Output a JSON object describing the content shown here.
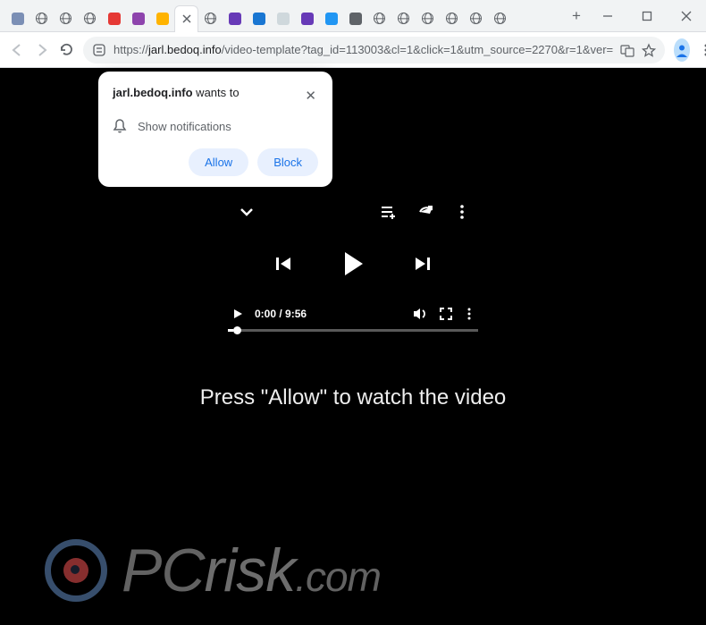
{
  "window": {
    "min": "—",
    "max": "▢",
    "close": "✕"
  },
  "tabs": {
    "count": 21,
    "newtab": "+",
    "colors": [
      "#7b8fb5",
      "#757575",
      "#757575",
      "#757575",
      "#e53935",
      "#8e44ad",
      "#ffb300",
      "#fff",
      "#757575",
      "#673ab7",
      "#1976d2",
      "#cfd8dc",
      "#673ab7",
      "#2196f3",
      "#5f6368",
      "#757575",
      "#757575",
      "#757575",
      "#757575",
      "#757575",
      "#757575"
    ],
    "globe_indexes": [
      1,
      2,
      3,
      8,
      15,
      16,
      17,
      18,
      19,
      20
    ]
  },
  "omnibox": {
    "protocol": "https://",
    "host": "jarl.bedoq.info",
    "path": "/video-template?tag_id=113003&cl=1&click=1&utm_source=2270&r=1&ver="
  },
  "notification": {
    "site": "jarl.bedoq.info",
    "wants": " wants to",
    "body": "Show notifications",
    "allow": "Allow",
    "block": "Block",
    "close": "✕"
  },
  "player": {
    "current": "0:00",
    "sep": " / ",
    "duration": "9:56"
  },
  "page": {
    "message": "Press \"Allow\" to watch the video"
  },
  "watermark": {
    "pc": "PC",
    "risk": "risk",
    "dot": ".com"
  }
}
